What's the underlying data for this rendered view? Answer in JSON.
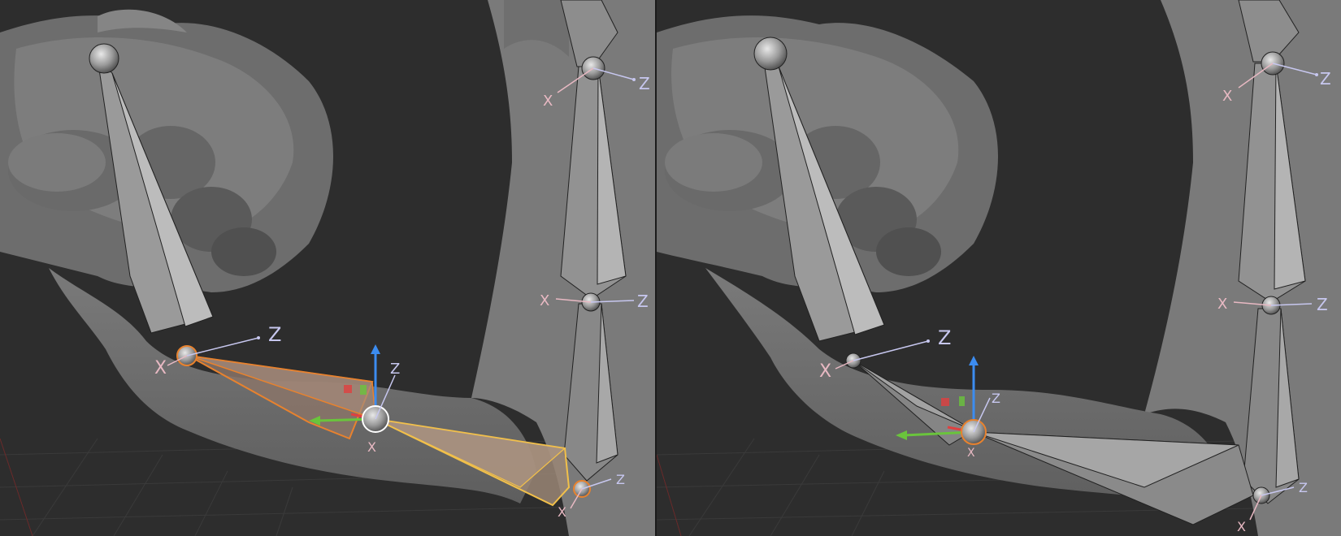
{
  "viewports": [
    {
      "id": "left",
      "state": "bones-selected",
      "axis_labels": {
        "jaw_root_z": "Z",
        "jaw_root_x": "X",
        "gizmo_z": "Z",
        "gizmo_x": "X",
        "spine_top_x": "X",
        "spine_top_z": "Z",
        "spine_mid_x": "X",
        "spine_mid_z": "Z",
        "spine_low_z": "Z",
        "spine_low_x": "X"
      }
    },
    {
      "id": "right",
      "state": "bones-deselected",
      "axis_labels": {
        "jaw_root_z": "Z",
        "jaw_root_x": "X",
        "gizmo_z": "Z",
        "gizmo_x": "X",
        "spine_top_x": "X",
        "spine_top_z": "Z",
        "spine_mid_x": "X",
        "spine_mid_z": "Z",
        "spine_low_z": "Z",
        "spine_low_x": "X"
      }
    }
  ],
  "colors": {
    "background": "#2d2d2d",
    "mesh": "#7e7e7e",
    "bone": "#8a8a8a",
    "selected_outline": "#e8822e",
    "active_outline": "#f2c04a",
    "gizmo_z": "#3c8cf0",
    "gizmo_y": "#6ac43c",
    "gizmo_x": "#e04040"
  }
}
